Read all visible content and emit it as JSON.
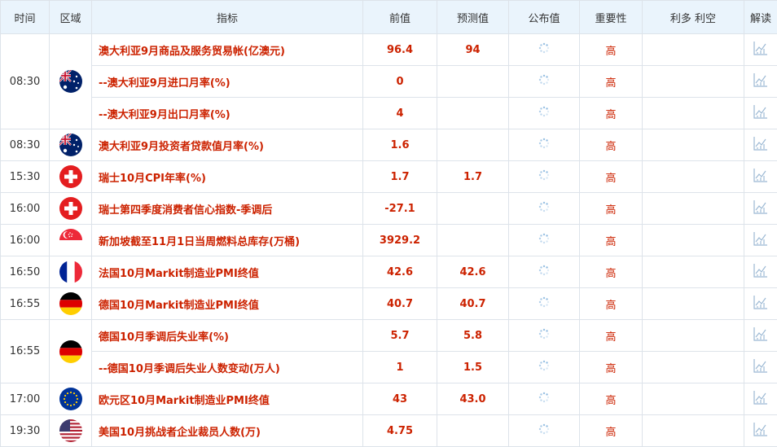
{
  "header": {
    "time": "时间",
    "region": "区域",
    "indicator": "指标",
    "previous": "前值",
    "forecast": "预测值",
    "actual": "公布值",
    "importance": "重要性",
    "impact": "利多 利空",
    "analysis": "解读"
  },
  "colors": {
    "header_bg": "#eaf4fc",
    "border": "#dde3ea",
    "accent_red": "#cc2200"
  },
  "rows": [
    {
      "time": "08:30",
      "flag": "australia-flag",
      "name": "澳大利亚9月商品及服务贸易帐(亿澳元)",
      "previous": "96.4",
      "forecast": "94",
      "actual": "",
      "importance": "高"
    },
    {
      "time": "",
      "flag": "",
      "name": "--澳大利亚9月进口月率(%)",
      "previous": "0",
      "forecast": "",
      "actual": "",
      "importance": "高"
    },
    {
      "time": "",
      "flag": "",
      "name": "--澳大利亚9月出口月率(%)",
      "previous": "4",
      "forecast": "",
      "actual": "",
      "importance": "高"
    },
    {
      "time": "08:30",
      "flag": "australia-flag",
      "name": "澳大利亚9月投资者贷款值月率(%)",
      "previous": "1.6",
      "forecast": "",
      "actual": "",
      "importance": "高"
    },
    {
      "time": "15:30",
      "flag": "switzerland-flag",
      "name": "瑞士10月CPI年率(%)",
      "previous": "1.7",
      "forecast": "1.7",
      "actual": "",
      "importance": "高"
    },
    {
      "time": "16:00",
      "flag": "switzerland-flag",
      "name": "瑞士第四季度消费者信心指数-季调后",
      "previous": "-27.1",
      "forecast": "",
      "actual": "",
      "importance": "高"
    },
    {
      "time": "16:00",
      "flag": "singapore-flag",
      "name": "新加坡截至11月1日当周燃料总库存(万桶)",
      "previous": "3929.2",
      "forecast": "",
      "actual": "",
      "importance": "高"
    },
    {
      "time": "16:50",
      "flag": "france-flag",
      "name": "法国10月Markit制造业PMI终值",
      "previous": "42.6",
      "forecast": "42.6",
      "actual": "",
      "importance": "高"
    },
    {
      "time": "16:55",
      "flag": "germany-flag",
      "name": "德国10月Markit制造业PMI终值",
      "previous": "40.7",
      "forecast": "40.7",
      "actual": "",
      "importance": "高"
    },
    {
      "time": "16:55",
      "flag": "germany-flag",
      "name": "德国10月季调后失业率(%)",
      "previous": "5.7",
      "forecast": "5.8",
      "actual": "",
      "importance": "高"
    },
    {
      "time": "",
      "flag": "",
      "name": "--德国10月季调后失业人数变动(万人)",
      "previous": "1",
      "forecast": "1.5",
      "actual": "",
      "importance": "高"
    },
    {
      "time": "17:00",
      "flag": "eu-flag",
      "name": "欧元区10月Markit制造业PMI终值",
      "previous": "43",
      "forecast": "43.0",
      "actual": "",
      "importance": "高"
    },
    {
      "time": "19:30",
      "flag": "usa-flag",
      "name": "美国10月挑战者企业裁员人数(万)",
      "previous": "4.75",
      "forecast": "",
      "actual": "",
      "importance": "高"
    }
  ]
}
